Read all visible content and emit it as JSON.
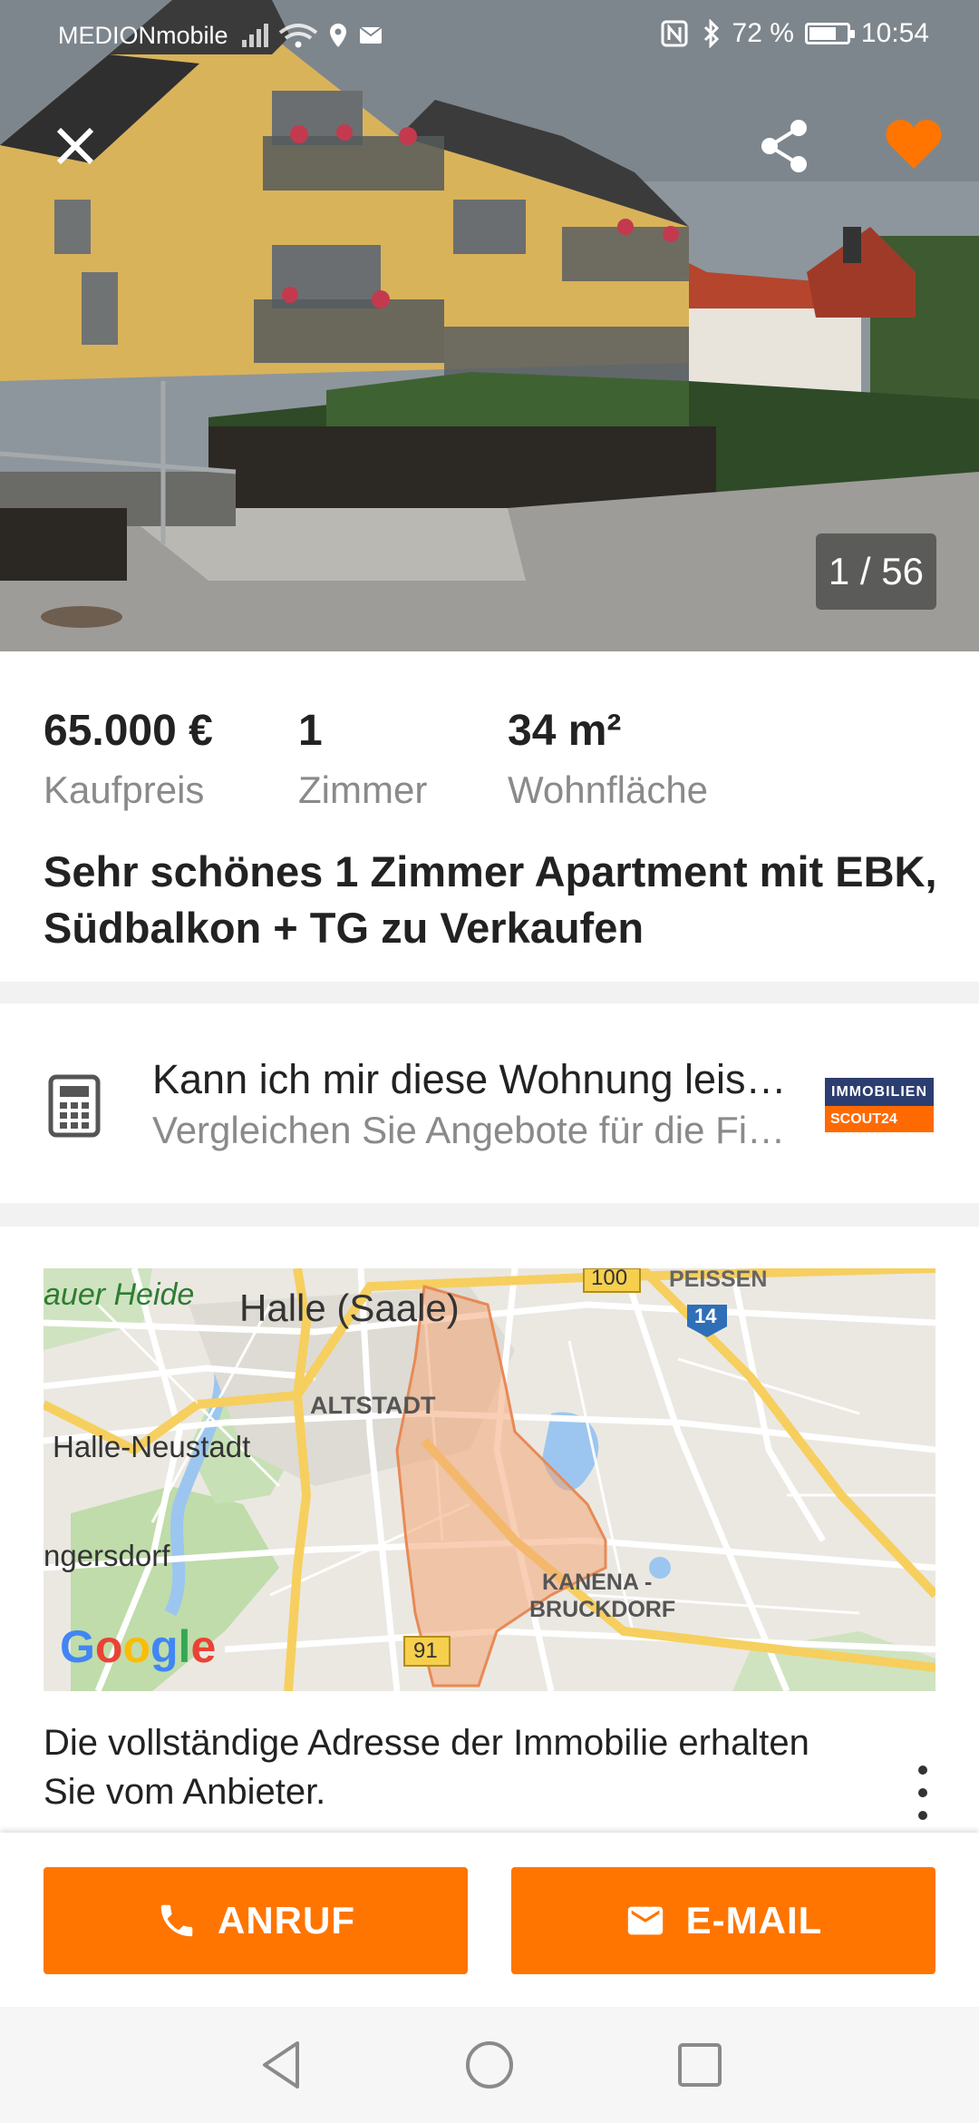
{
  "status_bar": {
    "carrier": "MEDIONmobile",
    "battery": "72 %",
    "battery_level": 0.72,
    "time": "10:54"
  },
  "gallery": {
    "counter": "1 / 56",
    "icons": {
      "close": "close-icon",
      "share": "share-icon",
      "favorite": "heart-icon"
    },
    "favorite_color": "#ff7500"
  },
  "summary": {
    "price": "65.000 €",
    "price_label": "Kaufpreis",
    "rooms": "1",
    "rooms_label": "Zimmer",
    "area": "34 m²",
    "area_label": "Wohnfläche"
  },
  "title": "Sehr schönes 1 Zimmer Apartment mit EBK, Südbalkon  + TG zu Verkaufen",
  "affordability": {
    "icon": "calculator-icon",
    "heading": "Kann ich mir diese Wohnung leisten?",
    "subtitle": "Vergleichen Sie Angebote für die Finanzierung",
    "logo_top": "IMMOBILIEN",
    "logo_bottom": "SCOUT24"
  },
  "map": {
    "labels": {
      "heide": "auer Heide",
      "halle": "Halle (Saale)",
      "altstadt": "ALTSTADT",
      "neustadt": "Halle-Neustadt",
      "gersdorf": "ngersdorf",
      "kanena1": "KANENA -",
      "kanena2": "BRUCKDORF",
      "peissen": "PEISSEN",
      "road100": "100",
      "road14": "14",
      "road91": "91"
    },
    "attribution": [
      "G",
      "o",
      "o",
      "g",
      "l",
      "e"
    ]
  },
  "address_note": "Die vollständige Adresse der Immobilie erhalten Sie vom Anbieter.",
  "actions": {
    "call": "ANRUF",
    "email": "E-MAIL",
    "accent": "#ff7500"
  },
  "nav": {
    "back": "back-icon",
    "home": "home-icon",
    "recents": "recents-icon"
  }
}
